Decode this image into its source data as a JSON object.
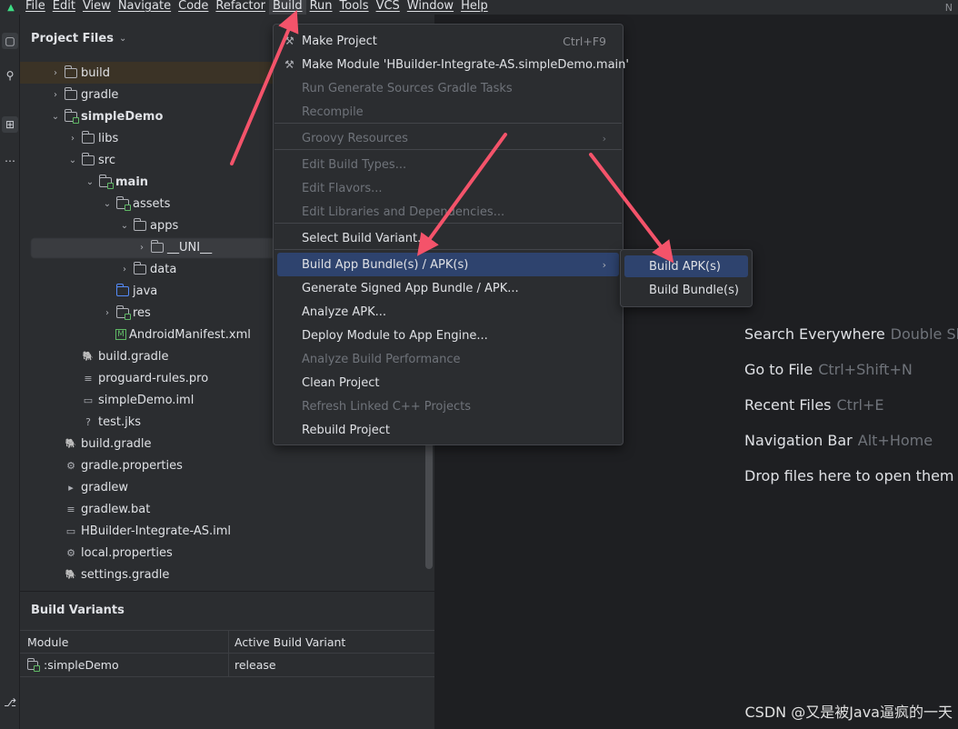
{
  "menubar": {
    "items": [
      "File",
      "Edit",
      "View",
      "Navigate",
      "Code",
      "Refactor",
      "Build",
      "Run",
      "Tools",
      "VCS",
      "Window",
      "Help"
    ],
    "active": "Build",
    "right_text": "N"
  },
  "project_panel": {
    "title": "Project Files",
    "tree": [
      {
        "label": "build",
        "depth": 0,
        "arrow": "›",
        "icon": "folder-icon",
        "bold": false
      },
      {
        "label": "gradle",
        "depth": 0,
        "arrow": "›",
        "icon": "folder-icon",
        "bold": false
      },
      {
        "label": "simpleDemo",
        "depth": 0,
        "arrow": "⌄",
        "icon": "module-folder-icon",
        "bold": true
      },
      {
        "label": "libs",
        "depth": 1,
        "arrow": "›",
        "icon": "folder-icon",
        "bold": false
      },
      {
        "label": "src",
        "depth": 1,
        "arrow": "⌄",
        "icon": "folder-icon",
        "bold": false
      },
      {
        "label": "main",
        "depth": 2,
        "arrow": "⌄",
        "icon": "module-folder-icon",
        "bold": true
      },
      {
        "label": "assets",
        "depth": 3,
        "arrow": "⌄",
        "icon": "module-folder-icon",
        "bold": false
      },
      {
        "label": "apps",
        "depth": 4,
        "arrow": "⌄",
        "icon": "folder-icon",
        "bold": false
      },
      {
        "label": "__UNI__",
        "depth": 5,
        "arrow": "›",
        "icon": "folder-icon",
        "bold": false
      },
      {
        "label": "data",
        "depth": 4,
        "arrow": "›",
        "icon": "folder-icon",
        "bold": false
      },
      {
        "label": "java",
        "depth": 3,
        "arrow": "",
        "icon": "source-folder-icon",
        "bold": false
      },
      {
        "label": "res",
        "depth": 3,
        "arrow": "›",
        "icon": "module-folder-icon",
        "bold": false
      },
      {
        "label": "AndroidManifest.xml",
        "depth": 3,
        "arrow": "",
        "icon": "manifest-icon",
        "bold": false
      },
      {
        "label": "build.gradle",
        "depth": 1,
        "arrow": "",
        "icon": "gradle-icon",
        "bold": false
      },
      {
        "label": "proguard-rules.pro",
        "depth": 1,
        "arrow": "",
        "icon": "text-file-icon",
        "bold": false
      },
      {
        "label": "simpleDemo.iml",
        "depth": 1,
        "arrow": "",
        "icon": "iml-file-icon",
        "bold": false
      },
      {
        "label": "test.jks",
        "depth": 1,
        "arrow": "",
        "icon": "unknown-file-icon",
        "bold": false
      },
      {
        "label": "build.gradle",
        "depth": 0,
        "arrow": "",
        "icon": "gradle-icon",
        "bold": false
      },
      {
        "label": "gradle.properties",
        "depth": 0,
        "arrow": "",
        "icon": "settings-file-icon",
        "bold": false
      },
      {
        "label": "gradlew",
        "depth": 0,
        "arrow": "",
        "icon": "terminal-file-icon",
        "bold": false
      },
      {
        "label": "gradlew.bat",
        "depth": 0,
        "arrow": "",
        "icon": "text-file-icon",
        "bold": false
      },
      {
        "label": "HBuilder-Integrate-AS.iml",
        "depth": 0,
        "arrow": "",
        "icon": "iml-file-icon",
        "bold": false
      },
      {
        "label": "local.properties",
        "depth": 0,
        "arrow": "",
        "icon": "settings-file-icon",
        "bold": false
      },
      {
        "label": "settings.gradle",
        "depth": 0,
        "arrow": "",
        "icon": "gradle-icon",
        "bold": false
      }
    ]
  },
  "build_variants": {
    "title": "Build Variants",
    "col_module": "Module",
    "col_variant": "Active Build Variant",
    "rows": [
      {
        "module": ":simpleDemo",
        "variant": "release"
      }
    ]
  },
  "build_menu": {
    "items": [
      {
        "label": "Make Project",
        "shortcut": "Ctrl+F9",
        "disabled": false,
        "submenu": false,
        "icon": "hammer-icon"
      },
      {
        "label": "Make Module 'HBuilder-Integrate-AS.simpleDemo.main'",
        "shortcut": "",
        "disabled": false,
        "submenu": false,
        "icon": "module-build-icon"
      },
      {
        "label": "Run Generate Sources Gradle Tasks",
        "shortcut": "",
        "disabled": true,
        "submenu": false,
        "icon": ""
      },
      {
        "label": "Recompile",
        "shortcut": "",
        "disabled": true,
        "submenu": false,
        "icon": ""
      },
      {
        "label": "Groovy Resources",
        "shortcut": "",
        "disabled": true,
        "submenu": true,
        "icon": ""
      },
      {
        "label": "Edit Build Types...",
        "shortcut": "",
        "disabled": true,
        "submenu": false,
        "icon": ""
      },
      {
        "label": "Edit Flavors...",
        "shortcut": "",
        "disabled": true,
        "submenu": false,
        "icon": ""
      },
      {
        "label": "Edit Libraries and Dependencies...",
        "shortcut": "",
        "disabled": true,
        "submenu": false,
        "icon": ""
      },
      {
        "label": "Select Build Variant...",
        "shortcut": "",
        "disabled": false,
        "submenu": false,
        "icon": ""
      },
      {
        "label": "Build App Bundle(s) / APK(s)",
        "shortcut": "",
        "disabled": false,
        "submenu": true,
        "icon": "",
        "selected": true
      },
      {
        "label": "Generate Signed App Bundle / APK...",
        "shortcut": "",
        "disabled": false,
        "submenu": false,
        "icon": ""
      },
      {
        "label": "Analyze APK...",
        "shortcut": "",
        "disabled": false,
        "submenu": false,
        "icon": ""
      },
      {
        "label": "Deploy Module to App Engine...",
        "shortcut": "",
        "disabled": false,
        "submenu": false,
        "icon": ""
      },
      {
        "label": "Analyze Build Performance",
        "shortcut": "",
        "disabled": true,
        "submenu": false,
        "icon": ""
      },
      {
        "label": "Clean Project",
        "shortcut": "",
        "disabled": false,
        "submenu": false,
        "icon": ""
      },
      {
        "label": "Refresh Linked C++ Projects",
        "shortcut": "",
        "disabled": true,
        "submenu": false,
        "icon": ""
      },
      {
        "label": "Rebuild Project",
        "shortcut": "",
        "disabled": false,
        "submenu": false,
        "icon": ""
      }
    ],
    "submenu_arrow": "›"
  },
  "submenu": {
    "items": [
      {
        "label": "Build APK(s)",
        "selected": true
      },
      {
        "label": "Build Bundle(s)",
        "selected": false
      }
    ]
  },
  "editor_hints": [
    {
      "label": "Search Everywhere",
      "keys": "Double Shi"
    },
    {
      "label": "Go to File",
      "keys": "Ctrl+Shift+N"
    },
    {
      "label": "Recent Files",
      "keys": "Ctrl+E"
    },
    {
      "label": "Navigation Bar",
      "keys": "Alt+Home"
    },
    {
      "label": "Drop files here to open them",
      "keys": ""
    }
  ],
  "annotation_color": "#f4536a",
  "watermark": "CSDN @又是被Java逼疯的一天"
}
